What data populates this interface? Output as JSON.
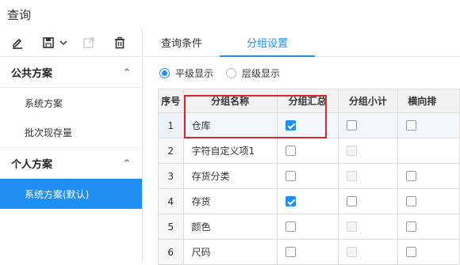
{
  "title": "查询",
  "toolbar": {
    "icons": [
      "edit-icon",
      "save-icon",
      "dropdown-icon",
      "export-icon",
      "delete-icon"
    ]
  },
  "sidebar": {
    "public_section": {
      "label": "公共方案",
      "items": [
        {
          "label": "系统方案"
        },
        {
          "label": "批次现存量"
        }
      ]
    },
    "personal_section": {
      "label": "个人方案",
      "items": [
        {
          "label": "系统方案(默认)",
          "active": true
        }
      ]
    }
  },
  "tabs": [
    {
      "label": "查询条件"
    },
    {
      "label": "分组设置",
      "active": true
    }
  ],
  "radios": [
    {
      "label": "平级显示",
      "checked": true
    },
    {
      "label": "层级显示",
      "checked": false
    }
  ],
  "table": {
    "headers": [
      "序号",
      "分组名称",
      "分组汇总",
      "分组小计",
      "横向排"
    ],
    "rows": [
      {
        "num": "1",
        "name": "仓库",
        "c1": "checked",
        "c2": "unchecked",
        "c3": "unchecked"
      },
      {
        "num": "2",
        "name": "字符自定义项1",
        "c1": "unchecked",
        "c2": "disabled",
        "c3": "none"
      },
      {
        "num": "3",
        "name": "存货分类",
        "c1": "unchecked",
        "c2": "disabled",
        "c3": "unchecked"
      },
      {
        "num": "4",
        "name": "存货",
        "c1": "checked",
        "c2": "unchecked",
        "c3": "unchecked"
      },
      {
        "num": "5",
        "name": "颜色",
        "c1": "unchecked",
        "c2": "disabled",
        "c3": "unchecked"
      },
      {
        "num": "6",
        "name": "尺码",
        "c1": "unchecked",
        "c2": "disabled",
        "c3": "unchecked"
      }
    ]
  },
  "colors": {
    "accent": "#1f8ef1",
    "highlight": "#d9262e"
  }
}
